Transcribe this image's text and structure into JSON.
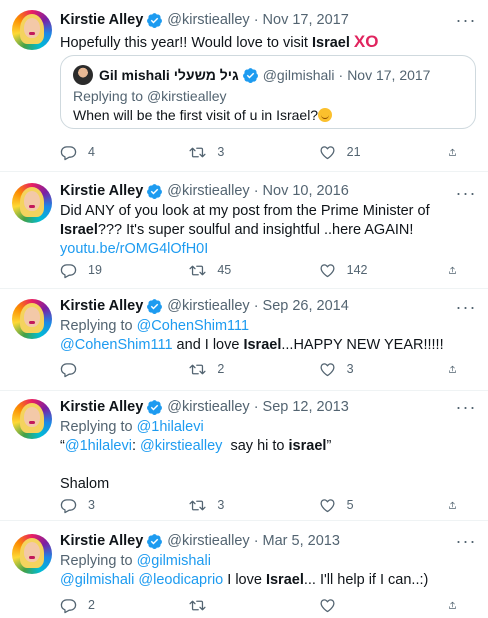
{
  "colors": {
    "accent": "#1d9bf0",
    "text": "#0f1419",
    "muted": "#536471",
    "xo": "#e0245e"
  },
  "tweets": [
    {
      "name": "Kirstie Alley",
      "handle": "@kirstiealley",
      "date": "Nov 17, 2017",
      "text_before": "Hopefully this year!! Would love to visit ",
      "highlight": "Israel",
      "xo": "XO",
      "quote": {
        "name": "Gil mishali גיל משעלי",
        "handle": "@gilmishali",
        "date": "Nov 17, 2017",
        "replying_prefix": "Replying to ",
        "replying_to": "@kirstiealley",
        "text": "When will be the first visit of u in Israel?"
      },
      "counts": {
        "replies": "4",
        "retweets": "3",
        "likes": "21"
      }
    },
    {
      "name": "Kirstie Alley",
      "handle": "@kirstiealley",
      "date": "Nov 10, 2016",
      "text_before": "Did ANY of you look at my post from the Prime Minister of ",
      "highlight": "Israel",
      "text_after": "??? It's super soulful and insightful ..here AGAIN!",
      "link": "youtu.be/rOMG4lOfH0I",
      "counts": {
        "replies": "19",
        "retweets": "45",
        "likes": "142"
      }
    },
    {
      "name": "Kirstie Alley",
      "handle": "@kirstiealley",
      "date": "Sep 26, 2014",
      "replying_prefix": "Replying to ",
      "replying_to": "@CohenShim111",
      "mention": "@CohenShim111",
      "text_mid": " and I love ",
      "highlight": "Israel",
      "text_after": "...HAPPY NEW YEAR!!!!!",
      "counts": {
        "replies": "",
        "retweets": "2",
        "likes": "3"
      }
    },
    {
      "name": "Kirstie Alley",
      "handle": "@kirstiealley",
      "date": "Sep 12, 2013",
      "replying_prefix": "Replying to ",
      "replying_to": "@1hilalevi",
      "quote_open": "“",
      "mention1": "@1hilalevi",
      "colon": ": ",
      "mention2": "@kirstiealley",
      "text_mid": "  say hi to ",
      "highlight": "israel",
      "quote_close": "”",
      "text2": "Shalom",
      "counts": {
        "replies": "3",
        "retweets": "3",
        "likes": "5"
      }
    },
    {
      "name": "Kirstie Alley",
      "handle": "@kirstiealley",
      "date": "Mar 5, 2013",
      "replying_prefix": "Replying to ",
      "replying_to": "@gilmishali",
      "mention1": "@gilmishali",
      "mention2": "@leodicaprio",
      "text_mid": " I love ",
      "highlight": "Israel",
      "text_after": "... I'll help if I can..:)",
      "counts": {
        "replies": "2",
        "retweets": "",
        "likes": ""
      }
    }
  ]
}
